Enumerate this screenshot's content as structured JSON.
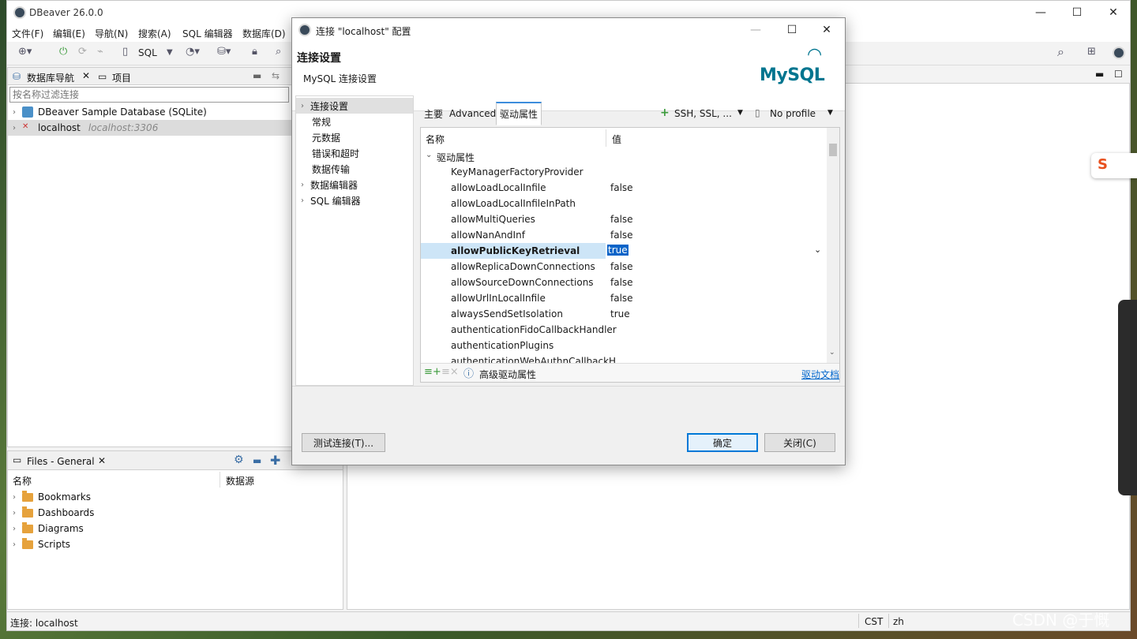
{
  "app": {
    "title": "DBeaver 26.0.0"
  },
  "menubar": [
    "文件(F)",
    "编辑(E)",
    "导航(N)",
    "搜索(A)",
    "SQL 编辑器",
    "数据库(D)"
  ],
  "toolbar": {
    "sql_label": "SQL"
  },
  "navigator": {
    "tab_label": "数据库导航",
    "projects_tab": "项目",
    "filter_placeholder": "按名称过滤连接",
    "items": [
      {
        "label": "DBeaver Sample Database (SQLite)",
        "sub": ""
      },
      {
        "label": "localhost",
        "sub": "localhost:3306"
      }
    ]
  },
  "files": {
    "tab_label": "Files - General",
    "col_name": "名称",
    "col_source": "数据源",
    "items": [
      "Bookmarks",
      "Dashboards",
      "Diagrams",
      "Scripts"
    ]
  },
  "statusbar": {
    "connection": "连接: localhost",
    "tz": "CST",
    "locale": "zh"
  },
  "watermark": "CSDN @于慨",
  "dialog": {
    "title": "连接 \"localhost\" 配置",
    "heading": "连接设置",
    "subheading": "MySQL 连接设置",
    "logo_text": "MySQL",
    "nav": [
      {
        "label": "连接设置",
        "expandable": true,
        "selected": true
      },
      {
        "label": "常规",
        "expandable": false
      },
      {
        "label": "元数据",
        "expandable": false
      },
      {
        "label": "错误和超时",
        "expandable": false
      },
      {
        "label": "数据传输",
        "expandable": false
      },
      {
        "label": "数据编辑器",
        "expandable": true
      },
      {
        "label": "SQL 编辑器",
        "expandable": true
      }
    ],
    "tabs": {
      "main": "主要",
      "advanced": "Advanced",
      "driver": "驱动属性",
      "ssh": "SSH, SSL, ...",
      "profile": "No profile"
    },
    "grid": {
      "col_name": "名称",
      "col_value": "值",
      "group": "驱动属性",
      "rows": [
        {
          "name": "KeyManagerFactoryProvider",
          "value": ""
        },
        {
          "name": "allowLoadLocalInfile",
          "value": "false"
        },
        {
          "name": "allowLoadLocalInfileInPath",
          "value": ""
        },
        {
          "name": "allowMultiQueries",
          "value": "false"
        },
        {
          "name": "allowNanAndInf",
          "value": "false"
        },
        {
          "name": "allowPublicKeyRetrieval",
          "value": "true"
        },
        {
          "name": "allowReplicaDownConnections",
          "value": "false"
        },
        {
          "name": "allowSourceDownConnections",
          "value": "false"
        },
        {
          "name": "allowUrlInLocalInfile",
          "value": "false"
        },
        {
          "name": "alwaysSendSetIsolation",
          "value": "true"
        },
        {
          "name": "authenticationFidoCallbackHandler",
          "value": ""
        },
        {
          "name": "authenticationPlugins",
          "value": ""
        },
        {
          "name": "authenticationWebAuthnCallbackH",
          "value": ""
        }
      ],
      "selected_index": 5
    },
    "footer": {
      "advanced": "高级驱动属性",
      "docs": "驱动文档"
    },
    "buttons": {
      "test": "测试连接(T)...",
      "ok": "确定",
      "close": "关闭(C)"
    }
  }
}
